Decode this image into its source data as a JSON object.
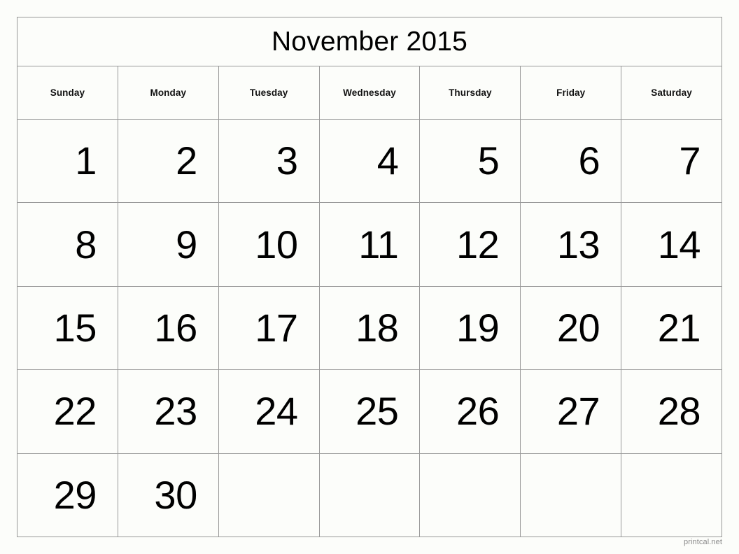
{
  "title": "November 2015",
  "weekdays": [
    "Sunday",
    "Monday",
    "Tuesday",
    "Wednesday",
    "Thursday",
    "Friday",
    "Saturday"
  ],
  "weeks": [
    [
      "1",
      "2",
      "3",
      "4",
      "5",
      "6",
      "7"
    ],
    [
      "8",
      "9",
      "10",
      "11",
      "12",
      "13",
      "14"
    ],
    [
      "15",
      "16",
      "17",
      "18",
      "19",
      "20",
      "21"
    ],
    [
      "22",
      "23",
      "24",
      "25",
      "26",
      "27",
      "28"
    ],
    [
      "29",
      "30",
      "",
      "",
      "",
      "",
      ""
    ]
  ],
  "footer": "printcal.net",
  "colors": {
    "background": "#fcfdfa",
    "gridline": "#999999",
    "text": "#000000",
    "footer_text": "#8a8a8a"
  }
}
